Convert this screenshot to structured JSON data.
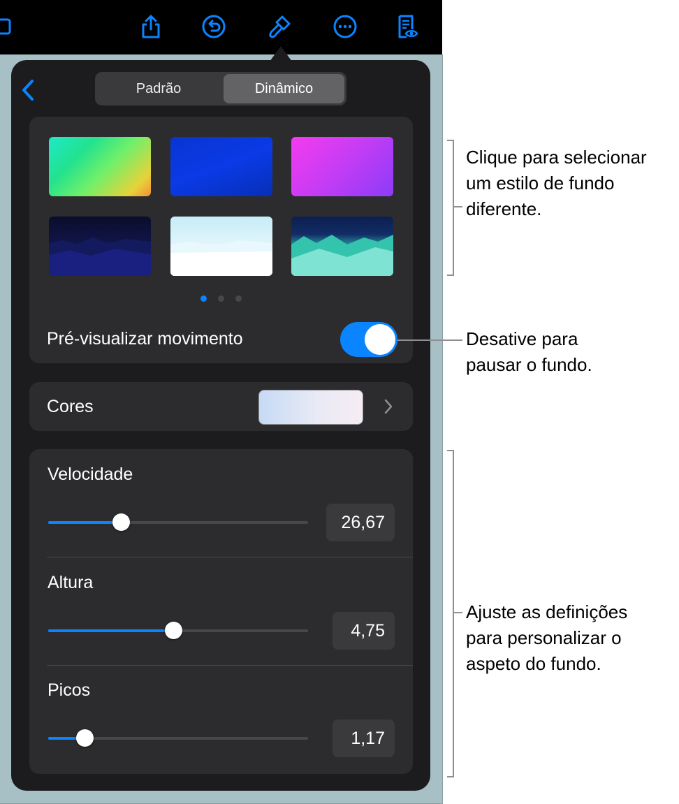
{
  "toolbar": {
    "icons": [
      "media-icon",
      "share-icon",
      "undo-icon",
      "format-brush-icon",
      "more-icon",
      "reading-view-icon"
    ]
  },
  "segmented": {
    "options": [
      "Padrão",
      "Dinâmico"
    ],
    "selected": "Dinâmico"
  },
  "styles": {
    "thumbnails": [
      "style-rainbow-gradient",
      "style-blue-gradient",
      "style-purple-gradient",
      "style-dark-mountains",
      "style-light-sky",
      "style-teal-mountains"
    ],
    "page_count": 3,
    "active_page": 1
  },
  "preview_motion": {
    "label": "Pré-visualizar movimento",
    "on": true
  },
  "colors": {
    "label": "Cores"
  },
  "sliders": [
    {
      "label": "Velocidade",
      "value": "26,67",
      "fraction": 0.28
    },
    {
      "label": "Altura",
      "value": "4,75",
      "fraction": 0.48
    },
    {
      "label": "Picos",
      "value": "1,17",
      "fraction": 0.14
    }
  ],
  "callouts": {
    "styles": "Clique para selecionar\num estilo de fundo\ndiferente.",
    "toggle": "Desative para\npausar o fundo.",
    "sliders": "Ajuste as definições\npara personalizar o\naspeto do fundo."
  },
  "theme": {
    "accent": "#0a84ff",
    "panel": "#1c1c1e",
    "card": "#2c2c2e"
  }
}
